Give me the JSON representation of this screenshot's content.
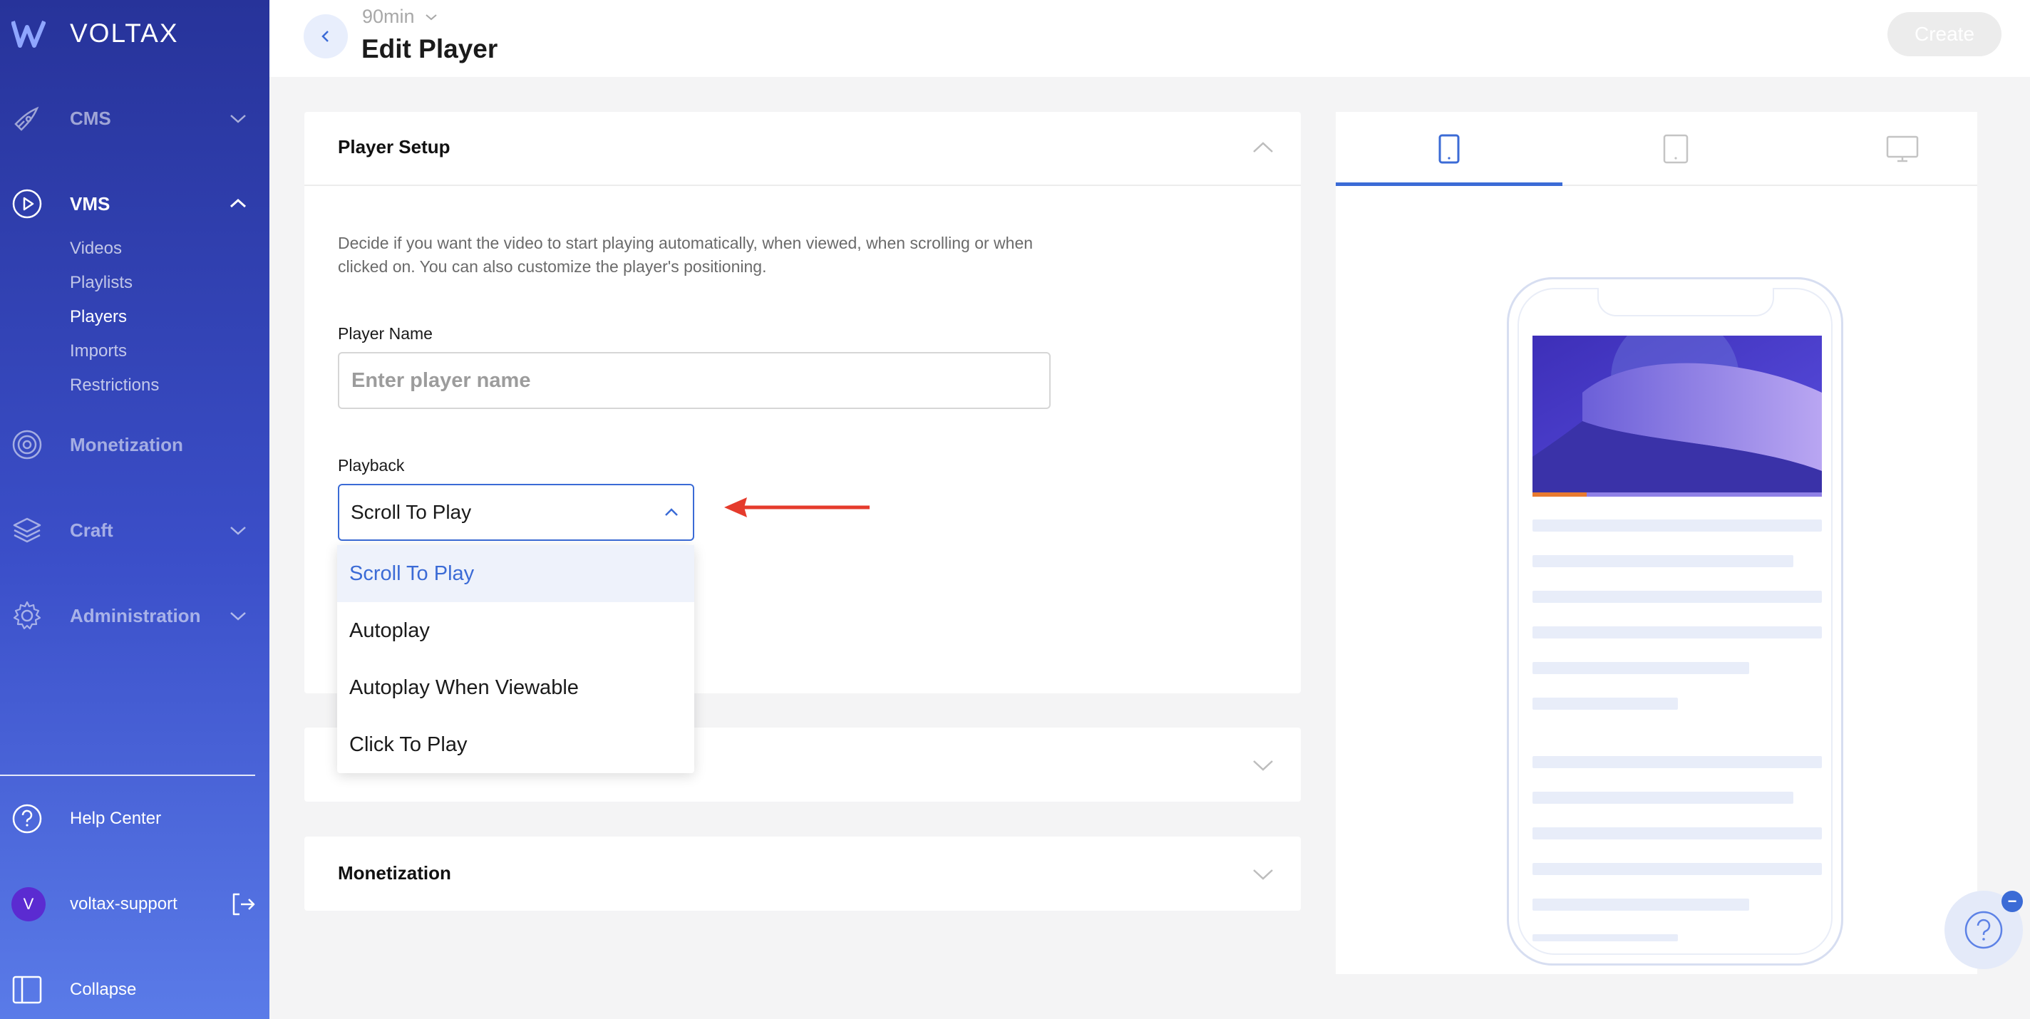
{
  "brand": {
    "name": "VOLTAX"
  },
  "sidebar": {
    "nav": [
      {
        "label": "CMS",
        "icon": "rocket-icon",
        "expanded": false
      },
      {
        "label": "VMS",
        "icon": "play-circle-icon",
        "expanded": true
      },
      {
        "label": "Monetization",
        "icon": "target-icon",
        "expanded": false
      },
      {
        "label": "Craft",
        "icon": "layers-icon",
        "expanded": false
      },
      {
        "label": "Administration",
        "icon": "gear-icon",
        "expanded": false
      }
    ],
    "vms_sub": [
      "Videos",
      "Playlists",
      "Players",
      "Imports",
      "Restrictions"
    ],
    "active_sub": "Players",
    "help_center": "Help Center",
    "user": {
      "initial": "V",
      "name": "voltax-support"
    },
    "collapse": "Collapse"
  },
  "header": {
    "org": "90min",
    "title": "Edit Player",
    "create_label": "Create"
  },
  "player_setup": {
    "title": "Player Setup",
    "description": "Decide if you want the video to start playing automatically, when viewed, when scrolling or when clicked on. You can also customize the player's positioning.",
    "name_label": "Player Name",
    "name_placeholder": "Enter player name",
    "name_value": "",
    "playback_label": "Playback",
    "playback_value": "Scroll To Play",
    "playback_options": [
      "Scroll To Play",
      "Autoplay",
      "Autoplay When Viewable",
      "Click To Play"
    ]
  },
  "monetization_section": {
    "title": "Monetization"
  },
  "preview": {
    "device_tabs": [
      "mobile-icon",
      "tablet-icon",
      "desktop-icon"
    ],
    "active_tab": 0
  },
  "colors": {
    "accent": "#3b6bd6",
    "annotation_arrow": "#e53b2c"
  }
}
